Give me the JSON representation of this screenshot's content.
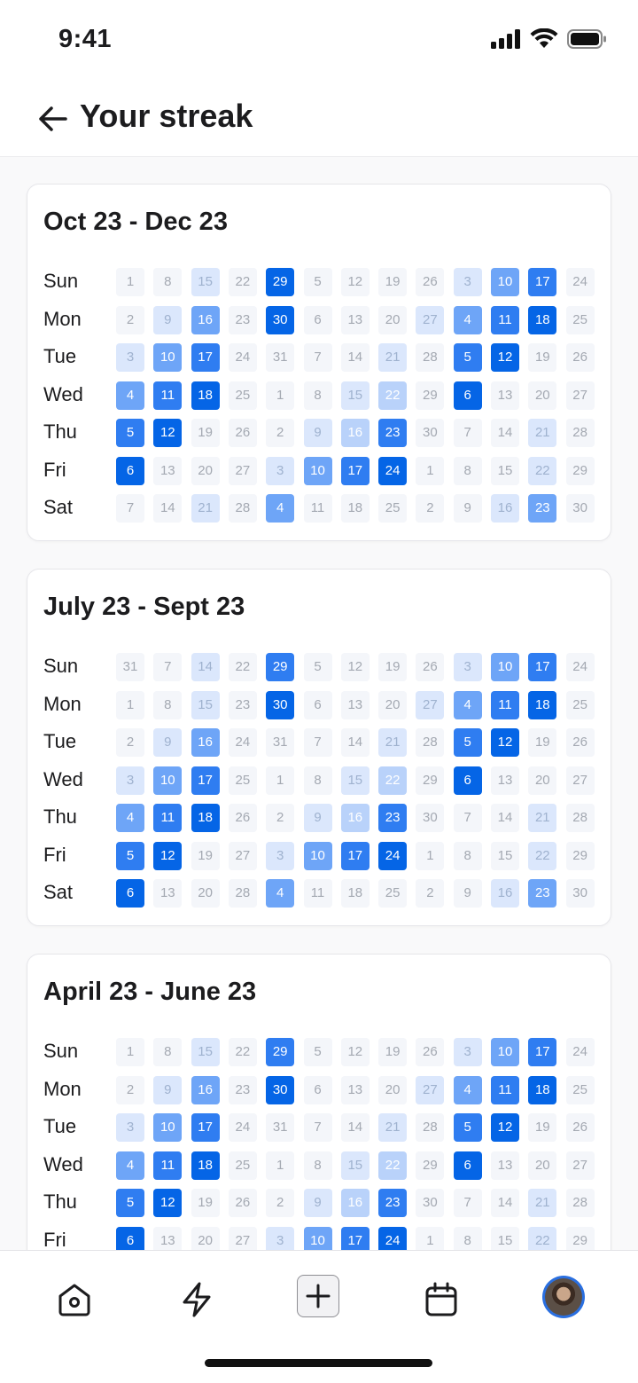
{
  "status_bar": {
    "time": "9:41"
  },
  "header": {
    "title": "Your streak"
  },
  "colors": {
    "accent": "#0565e6",
    "level_0": "#f4f6fa",
    "level_1": "#dbe7fc",
    "level_2": "#b9d2fa",
    "level_3": "#6ea5f7",
    "level_4": "#2f7df1",
    "level_5": "#0565e6"
  },
  "day_labels": [
    "Sun",
    "Mon",
    "Tue",
    "Wed",
    "Thu",
    "Fri",
    "Sat"
  ],
  "cards": [
    {
      "title": "Oct 23 - Dec 23",
      "rows": [
        {
          "day": "Sun",
          "days": [
            "1",
            "8",
            "15",
            "22",
            "29",
            "5",
            "12",
            "19",
            "26",
            "3",
            "10",
            "17",
            "24"
          ],
          "levels": [
            0,
            0,
            1,
            0,
            5,
            0,
            0,
            0,
            0,
            1,
            3,
            4,
            0
          ]
        },
        {
          "day": "Mon",
          "days": [
            "2",
            "9",
            "16",
            "23",
            "30",
            "6",
            "13",
            "20",
            "27",
            "4",
            "11",
            "18",
            "25"
          ],
          "levels": [
            0,
            1,
            3,
            0,
            5,
            0,
            0,
            0,
            1,
            3,
            4,
            5,
            0
          ]
        },
        {
          "day": "Tue",
          "days": [
            "3",
            "10",
            "17",
            "24",
            "31",
            "7",
            "14",
            "21",
            "28",
            "5",
            "12",
            "19",
            "26"
          ],
          "levels": [
            1,
            3,
            4,
            0,
            0,
            0,
            0,
            1,
            0,
            4,
            5,
            0,
            0
          ]
        },
        {
          "day": "Wed",
          "days": [
            "4",
            "11",
            "18",
            "25",
            "1",
            "8",
            "15",
            "22",
            "29",
            "6",
            "13",
            "20",
            "27"
          ],
          "levels": [
            3,
            4,
            5,
            0,
            0,
            0,
            1,
            2,
            0,
            5,
            0,
            0,
            0
          ]
        },
        {
          "day": "Thu",
          "days": [
            "5",
            "12",
            "19",
            "26",
            "2",
            "9",
            "16",
            "23",
            "30",
            "7",
            "14",
            "21",
            "28"
          ],
          "levels": [
            4,
            5,
            0,
            0,
            0,
            1,
            2,
            4,
            0,
            0,
            0,
            1,
            0
          ]
        },
        {
          "day": "Fri",
          "days": [
            "6",
            "13",
            "20",
            "27",
            "3",
            "10",
            "17",
            "24",
            "1",
            "8",
            "15",
            "22",
            "29"
          ],
          "levels": [
            5,
            0,
            0,
            0,
            1,
            3,
            4,
            5,
            0,
            0,
            0,
            1,
            0
          ]
        },
        {
          "day": "Sat",
          "days": [
            "7",
            "14",
            "21",
            "28",
            "4",
            "11",
            "18",
            "25",
            "2",
            "9",
            "16",
            "23",
            "30"
          ],
          "levels": [
            0,
            0,
            1,
            0,
            3,
            0,
            0,
            0,
            0,
            0,
            1,
            3,
            0
          ]
        }
      ]
    },
    {
      "title": "July 23 - Sept 23",
      "rows": [
        {
          "day": "Sun",
          "days": [
            "31",
            "7",
            "14",
            "22",
            "29",
            "5",
            "12",
            "19",
            "26",
            "3",
            "10",
            "17",
            "24"
          ],
          "levels": [
            0,
            0,
            1,
            0,
            4,
            0,
            0,
            0,
            0,
            1,
            3,
            4,
            0
          ]
        },
        {
          "day": "Mon",
          "days": [
            "1",
            "8",
            "15",
            "23",
            "30",
            "6",
            "13",
            "20",
            "27",
            "4",
            "11",
            "18",
            "25"
          ],
          "levels": [
            0,
            0,
            1,
            0,
            5,
            0,
            0,
            0,
            1,
            3,
            4,
            5,
            0
          ]
        },
        {
          "day": "Tue",
          "days": [
            "2",
            "9",
            "16",
            "24",
            "31",
            "7",
            "14",
            "21",
            "28",
            "5",
            "12",
            "19",
            "26"
          ],
          "levels": [
            0,
            1,
            3,
            0,
            0,
            0,
            0,
            1,
            0,
            4,
            5,
            0,
            0
          ]
        },
        {
          "day": "Wed",
          "days": [
            "3",
            "10",
            "17",
            "25",
            "1",
            "8",
            "15",
            "22",
            "29",
            "6",
            "13",
            "20",
            "27"
          ],
          "levels": [
            1,
            3,
            4,
            0,
            0,
            0,
            1,
            2,
            0,
            5,
            0,
            0,
            0
          ]
        },
        {
          "day": "Thu",
          "days": [
            "4",
            "11",
            "18",
            "26",
            "2",
            "9",
            "16",
            "23",
            "30",
            "7",
            "14",
            "21",
            "28"
          ],
          "levels": [
            3,
            4,
            5,
            0,
            0,
            1,
            2,
            4,
            0,
            0,
            0,
            1,
            0
          ]
        },
        {
          "day": "Fri",
          "days": [
            "5",
            "12",
            "19",
            "27",
            "3",
            "10",
            "17",
            "24",
            "1",
            "8",
            "15",
            "22",
            "29"
          ],
          "levels": [
            4,
            5,
            0,
            0,
            1,
            3,
            4,
            5,
            0,
            0,
            0,
            1,
            0
          ]
        },
        {
          "day": "Sat",
          "days": [
            "6",
            "13",
            "20",
            "28",
            "4",
            "11",
            "18",
            "25",
            "2",
            "9",
            "16",
            "23",
            "30"
          ],
          "levels": [
            5,
            0,
            0,
            0,
            3,
            0,
            0,
            0,
            0,
            0,
            1,
            3,
            0
          ]
        }
      ]
    },
    {
      "title": "April 23 - June 23",
      "rows": [
        {
          "day": "Sun",
          "days": [
            "1",
            "8",
            "15",
            "22",
            "29",
            "5",
            "12",
            "19",
            "26",
            "3",
            "10",
            "17",
            "24"
          ],
          "levels": [
            0,
            0,
            1,
            0,
            4,
            0,
            0,
            0,
            0,
            1,
            3,
            4,
            0
          ]
        },
        {
          "day": "Mon",
          "days": [
            "2",
            "9",
            "16",
            "23",
            "30",
            "6",
            "13",
            "20",
            "27",
            "4",
            "11",
            "18",
            "25"
          ],
          "levels": [
            0,
            1,
            3,
            0,
            5,
            0,
            0,
            0,
            1,
            3,
            4,
            5,
            0
          ]
        },
        {
          "day": "Tue",
          "days": [
            "3",
            "10",
            "17",
            "24",
            "31",
            "7",
            "14",
            "21",
            "28",
            "5",
            "12",
            "19",
            "26"
          ],
          "levels": [
            1,
            3,
            4,
            0,
            0,
            0,
            0,
            1,
            0,
            4,
            5,
            0,
            0
          ]
        },
        {
          "day": "Wed",
          "days": [
            "4",
            "11",
            "18",
            "25",
            "1",
            "8",
            "15",
            "22",
            "29",
            "6",
            "13",
            "20",
            "27"
          ],
          "levels": [
            3,
            4,
            5,
            0,
            0,
            0,
            1,
            2,
            0,
            5,
            0,
            0,
            0
          ]
        },
        {
          "day": "Thu",
          "days": [
            "5",
            "12",
            "19",
            "26",
            "2",
            "9",
            "16",
            "23",
            "30",
            "7",
            "14",
            "21",
            "28"
          ],
          "levels": [
            4,
            5,
            0,
            0,
            0,
            1,
            2,
            4,
            0,
            0,
            0,
            1,
            0
          ]
        },
        {
          "day": "Fri",
          "days": [
            "6",
            "13",
            "20",
            "27",
            "3",
            "10",
            "17",
            "24",
            "1",
            "8",
            "15",
            "22",
            "29"
          ],
          "levels": [
            5,
            0,
            0,
            0,
            1,
            3,
            4,
            5,
            0,
            0,
            0,
            1,
            0
          ]
        }
      ]
    }
  ],
  "tab_bar": {
    "items": [
      {
        "icon": "home-icon"
      },
      {
        "icon": "lightning-icon"
      },
      {
        "icon": "plus-icon"
      },
      {
        "icon": "calendar-icon"
      },
      {
        "icon": "avatar"
      }
    ]
  }
}
